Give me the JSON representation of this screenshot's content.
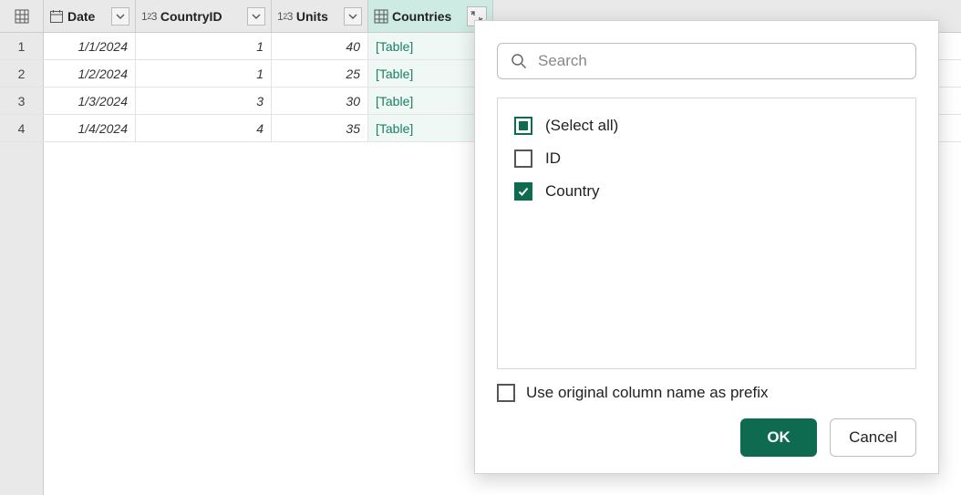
{
  "columns": {
    "date": {
      "label": "Date"
    },
    "countryId": {
      "label": "CountryID"
    },
    "units": {
      "label": "Units"
    },
    "countries": {
      "label": "Countries"
    }
  },
  "rows": [
    {
      "n": "1",
      "date": "1/1/2024",
      "cid": "1",
      "units": "40",
      "countries": "[Table]"
    },
    {
      "n": "2",
      "date": "1/2/2024",
      "cid": "1",
      "units": "25",
      "countries": "[Table]"
    },
    {
      "n": "3",
      "date": "1/3/2024",
      "cid": "3",
      "units": "30",
      "countries": "[Table]"
    },
    {
      "n": "4",
      "date": "1/4/2024",
      "cid": "4",
      "units": "35",
      "countries": "[Table]"
    }
  ],
  "popup": {
    "search_placeholder": "Search",
    "options": {
      "select_all": "(Select all)",
      "id": "ID",
      "country": "Country"
    },
    "prefix_label": "Use original column name as prefix",
    "ok": "OK",
    "cancel": "Cancel"
  }
}
